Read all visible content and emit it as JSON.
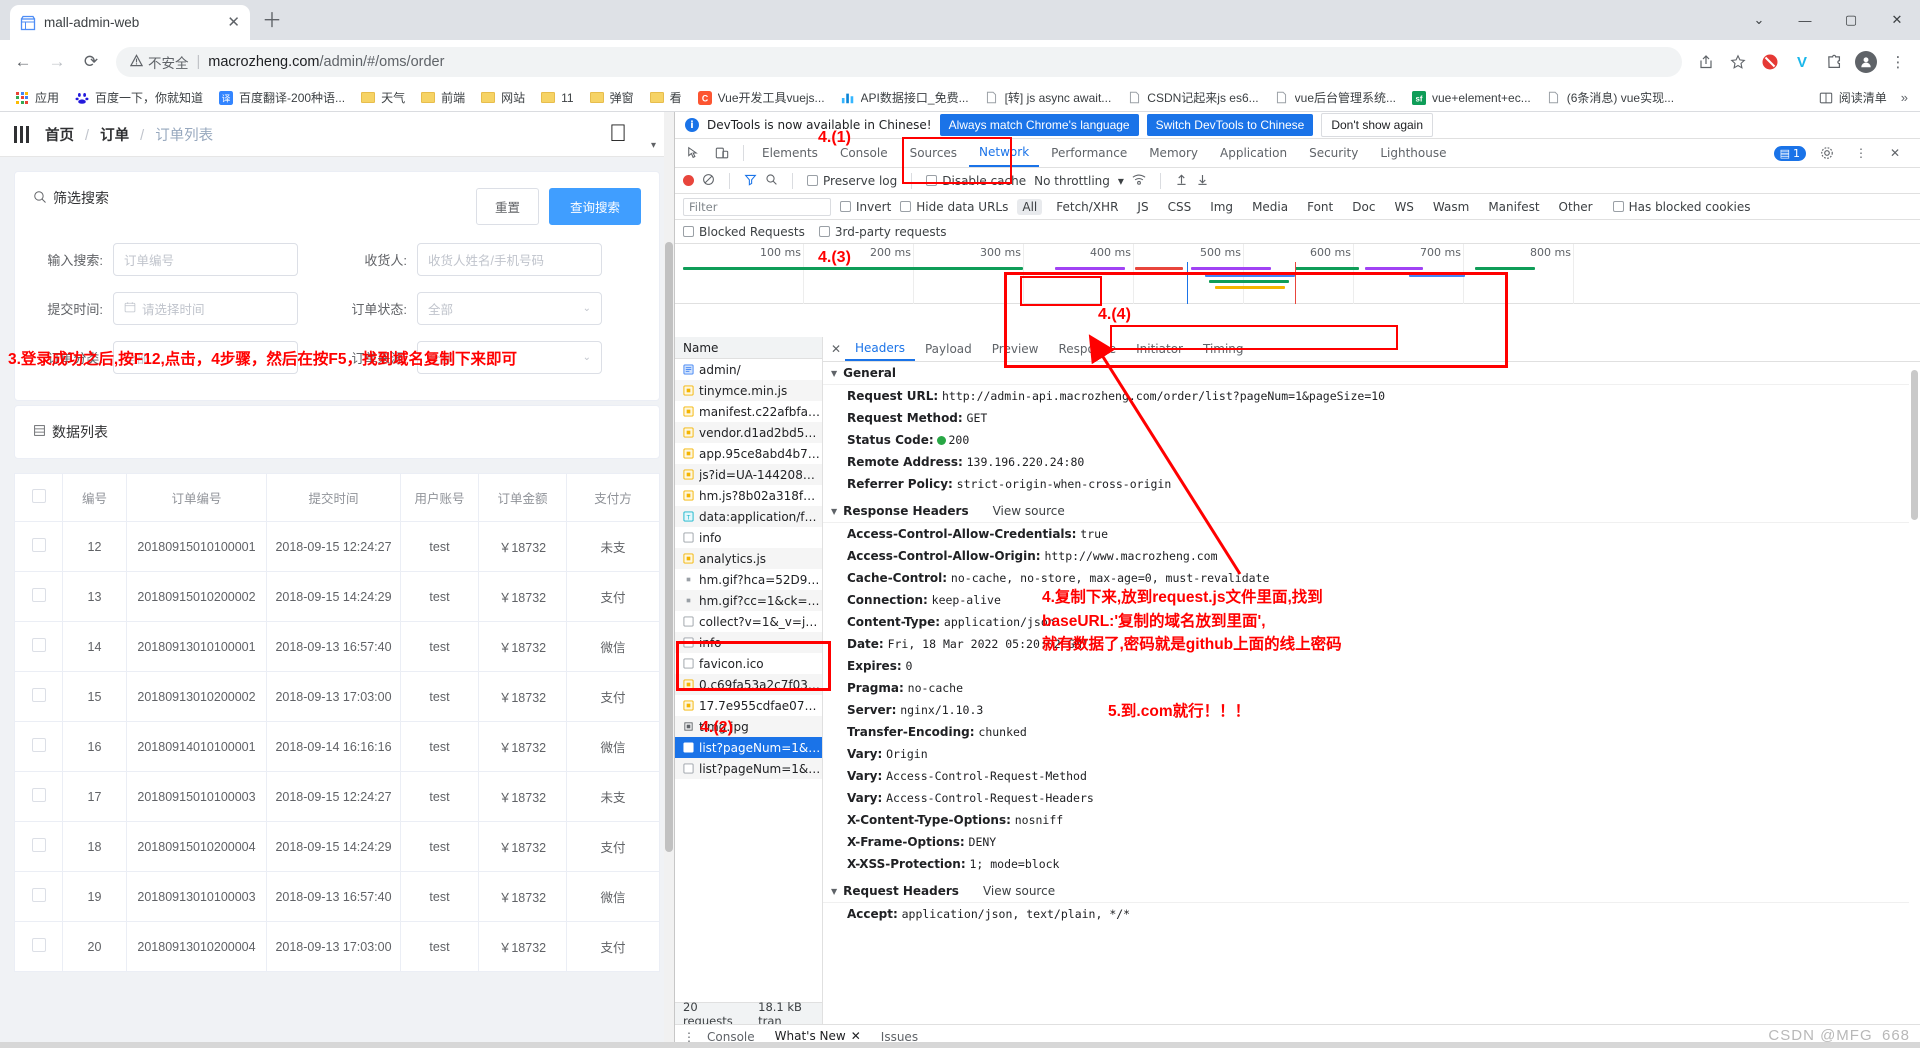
{
  "browser": {
    "tab": {
      "title": "mall-admin-web",
      "favicon_icon": "store-icon",
      "close_icon": "✕"
    },
    "new_tab_icon": "＋",
    "window_controls": {
      "minimize": "—",
      "maximize": "▢",
      "close": "✕",
      "chevron": "⌄"
    },
    "nav": {
      "back": "←",
      "forward": "→",
      "reload": "⟳"
    },
    "omnibox": {
      "security_warning": "不安全",
      "warning_icon": "warning-triangle-icon",
      "url_host": "macrozheng.com",
      "url_path": "/admin/#/oms/order"
    },
    "toolbar_icons": [
      "share-icon",
      "star-icon",
      "adblock-icon",
      "vimeo-icon",
      "puzzle-icon",
      "profile-icon",
      "menu-icon"
    ],
    "bookmarks": [
      {
        "label": "应用",
        "icon": "apps-grid-icon"
      },
      {
        "label": "百度一下，你就知道",
        "icon": "baidu-icon"
      },
      {
        "label": "百度翻译-200种语...",
        "icon": "translate-icon"
      },
      {
        "label": "天气",
        "icon": "folder-icon"
      },
      {
        "label": "前端",
        "icon": "folder-icon"
      },
      {
        "label": "网站",
        "icon": "folder-icon"
      },
      {
        "label": "11",
        "icon": "folder-icon"
      },
      {
        "label": "弹窗",
        "icon": "folder-icon"
      },
      {
        "label": "看",
        "icon": "folder-icon"
      },
      {
        "label": "Vue开发工具vuejs...",
        "icon": "csdn-icon"
      },
      {
        "label": "API数据接口_免费...",
        "icon": "chart-icon"
      },
      {
        "label": "[转] js async await...",
        "icon": "doc-icon"
      },
      {
        "label": "CSDN记起来js es6...",
        "icon": "doc-icon"
      },
      {
        "label": "vue后台管理系统...",
        "icon": "doc-icon"
      },
      {
        "label": "vue+element+ec...",
        "icon": "sf-icon"
      },
      {
        "label": "(6条消息) vue实现...",
        "icon": "doc-icon"
      }
    ],
    "bookmarks_right": {
      "label": "阅读清单",
      "icon": "reading-list-icon",
      "overflow_icon": "»"
    }
  },
  "app": {
    "breadcrumb": {
      "home": "首页",
      "section": "订单",
      "current": "订单列表",
      "separator": "/"
    },
    "hamburger_icon": "hamburger-icon",
    "apple_icon": "apple-logo-icon",
    "filter_card": {
      "title": "筛选搜索",
      "search_icon": "search-icon",
      "reset_label": "重置",
      "query_label": "查询搜索",
      "fields": [
        {
          "label": "输入搜索:",
          "placeholder": "订单编号",
          "type": "text"
        },
        {
          "label": "收货人:",
          "placeholder": "收货人姓名/手机号码",
          "type": "text"
        },
        {
          "label": "提交时间:",
          "placeholder": "请选择时间",
          "type": "date",
          "icon": "calendar-icon"
        },
        {
          "label": "订单状态:",
          "placeholder": "全部",
          "type": "select"
        },
        {
          "label": "订单分类:",
          "placeholder": "全部",
          "type": "select"
        },
        {
          "label": "订单来源:",
          "placeholder": "全部",
          "type": "select"
        }
      ]
    },
    "list_card": {
      "title": "数据列表",
      "icon": "list-icon"
    },
    "table": {
      "columns": [
        "",
        "编号",
        "订单编号",
        "提交时间",
        "用户账号",
        "订单金额",
        "支付方"
      ],
      "rows": [
        {
          "id": "12",
          "order_no": "20180915010100001",
          "time": "2018-09-15 12:24:27",
          "user": "test",
          "amount": "￥18732",
          "pay": "未支"
        },
        {
          "id": "13",
          "order_no": "20180915010200002",
          "time": "2018-09-15 14:24:29",
          "user": "test",
          "amount": "￥18732",
          "pay": "支付"
        },
        {
          "id": "14",
          "order_no": "20180913010100001",
          "time": "2018-09-13 16:57:40",
          "user": "test",
          "amount": "￥18732",
          "pay": "微信"
        },
        {
          "id": "15",
          "order_no": "20180913010200002",
          "time": "2018-09-13 17:03:00",
          "user": "test",
          "amount": "￥18732",
          "pay": "支付"
        },
        {
          "id": "16",
          "order_no": "20180914010100001",
          "time": "2018-09-14 16:16:16",
          "user": "test",
          "amount": "￥18732",
          "pay": "微信"
        },
        {
          "id": "17",
          "order_no": "20180915010100003",
          "time": "2018-09-15 12:24:27",
          "user": "test",
          "amount": "￥18732",
          "pay": "未支"
        },
        {
          "id": "18",
          "order_no": "20180915010200004",
          "time": "2018-09-15 14:24:29",
          "user": "test",
          "amount": "￥18732",
          "pay": "支付"
        },
        {
          "id": "19",
          "order_no": "20180913010100003",
          "time": "2018-09-13 16:57:40",
          "user": "test",
          "amount": "￥18732",
          "pay": "微信"
        },
        {
          "id": "20",
          "order_no": "20180913010200004",
          "time": "2018-09-13 17:03:00",
          "user": "test",
          "amount": "￥18732",
          "pay": "支付"
        }
      ]
    }
  },
  "devtools": {
    "banner": {
      "text": "DevTools is now available in Chinese!",
      "always_match": "Always match Chrome's language",
      "switch": "Switch DevTools to Chinese",
      "dont_show": "Don't show again"
    },
    "tabs": [
      "Elements",
      "Console",
      "Sources",
      "Network",
      "Performance",
      "Memory",
      "Application",
      "Security",
      "Lighthouse"
    ],
    "active_tab": "Network",
    "tab_icons": [
      "inspect-icon",
      "device-toolbar-icon"
    ],
    "right_icons": {
      "issues_count": "1",
      "settings_icon": "gear-icon",
      "more_icon": "kebab-icon",
      "close_icon": "close-icon"
    },
    "toolbar": {
      "record_icon": "record-icon",
      "clear_icon": "clear-icon",
      "filter_icon": "filter-funnel-icon",
      "search_icon": "search-icon",
      "preserve_log": "Preserve log",
      "disable_cache": "Disable cache",
      "throttling": "No throttling",
      "throttle_caret": "▾",
      "wifi_icon": "network-conditions-icon",
      "import_icon": "import-har-icon",
      "export_icon": "export-har-icon"
    },
    "filterbar": {
      "placeholder": "Filter",
      "invert": "Invert",
      "hide_data_urls": "Hide data URLs",
      "types": [
        "All",
        "Fetch/XHR",
        "JS",
        "CSS",
        "Img",
        "Media",
        "Font",
        "Doc",
        "WS",
        "Wasm",
        "Manifest",
        "Other"
      ],
      "active_type": "All",
      "has_blocked_cookies": "Has blocked cookies",
      "blocked_requests": "Blocked Requests",
      "third_party": "3rd-party requests"
    },
    "overview_ticks": [
      "100 ms",
      "200 ms",
      "300 ms",
      "400 ms",
      "500 ms",
      "600 ms",
      "700 ms",
      "800 ms"
    ],
    "name_column_header": "Name",
    "requests": [
      {
        "name": "admin/",
        "icon": "doc-icon",
        "type": "doc"
      },
      {
        "name": "tinymce.min.js",
        "icon": "js-icon",
        "type": "js"
      },
      {
        "name": "manifest.c22afbfaa36...",
        "icon": "js-icon",
        "type": "js"
      },
      {
        "name": "vendor.d1ad2bd51fe...",
        "icon": "js-icon",
        "type": "js"
      },
      {
        "name": "app.95ce8abd4b7179...",
        "icon": "js-icon",
        "type": "js"
      },
      {
        "name": "js?id=UA-144208445-2",
        "icon": "js-icon",
        "type": "js"
      },
      {
        "name": "hm.js?8b02a318fde58...",
        "icon": "js-icon",
        "type": "js"
      },
      {
        "name": "data:application/fo...",
        "icon": "font-icon",
        "type": "font"
      },
      {
        "name": "info",
        "icon": "xhr-icon",
        "type": "xhr"
      },
      {
        "name": "analytics.js",
        "icon": "js-icon",
        "type": "js"
      },
      {
        "name": "hm.gif?hca=52D98BA...",
        "icon": "img-icon",
        "type": "img"
      },
      {
        "name": "hm.gif?cc=1&ck=1&c...",
        "icon": "img-icon",
        "type": "img"
      },
      {
        "name": "collect?v=1&_v=j96&...",
        "icon": "xhr-icon",
        "type": "xhr"
      },
      {
        "name": "info",
        "icon": "xhr-icon",
        "type": "xhr"
      },
      {
        "name": "favicon.ico",
        "icon": "xhr-icon",
        "type": "other"
      },
      {
        "name": "0.c69fa53a2c7f03ae2...",
        "icon": "js-icon",
        "type": "js"
      },
      {
        "name": "17.7e955cdfae074128...",
        "icon": "js-icon",
        "type": "js"
      },
      {
        "name": "timg.jpg",
        "icon": "img-icon",
        "type": "img"
      },
      {
        "name": "list?pageNum=1&pa...",
        "icon": "xhr-icon",
        "type": "xhr",
        "selected": true
      },
      {
        "name": "list?pageNum=1&pa...",
        "icon": "xhr-icon",
        "type": "xhr"
      }
    ],
    "footer": {
      "requests": "20 requests",
      "transferred": "18.1 kB tran"
    },
    "detail_tabs": [
      "Headers",
      "Payload",
      "Preview",
      "Response",
      "Initiator",
      "Timing"
    ],
    "detail_active_tab": "Headers",
    "general": {
      "title": "General",
      "request_url_key": "Request URL:",
      "request_url_highlight": "http://admin-api.macrozheng.com",
      "request_url_rest": "/order/list?pageNum=1&pageSize=10",
      "request_method_key": "Request Method:",
      "request_method": "GET",
      "status_key": "Status Code:",
      "status": "200",
      "remote_key": "Remote Address:",
      "remote": "139.196.220.24:80",
      "referrer_key": "Referrer Policy:",
      "referrer": "strict-origin-when-cross-origin"
    },
    "response_headers": {
      "title": "Response Headers",
      "view_source": "View source",
      "items": [
        {
          "k": "Access-Control-Allow-Credentials:",
          "v": "true"
        },
        {
          "k": "Access-Control-Allow-Origin:",
          "v": "http://www.macrozheng.com"
        },
        {
          "k": "Cache-Control:",
          "v": "no-cache, no-store, max-age=0, must-revalidate"
        },
        {
          "k": "Connection:",
          "v": "keep-alive"
        },
        {
          "k": "Content-Type:",
          "v": "application/json"
        },
        {
          "k": "Date:",
          "v": "Fri, 18 Mar 2022 05:20:02 GMT"
        },
        {
          "k": "Expires:",
          "v": "0"
        },
        {
          "k": "Pragma:",
          "v": "no-cache"
        },
        {
          "k": "Server:",
          "v": "nginx/1.10.3"
        },
        {
          "k": "Transfer-Encoding:",
          "v": "chunked"
        },
        {
          "k": "Vary:",
          "v": "Origin"
        },
        {
          "k": "Vary:",
          "v": "Access-Control-Request-Method"
        },
        {
          "k": "Vary:",
          "v": "Access-Control-Request-Headers"
        },
        {
          "k": "X-Content-Type-Options:",
          "v": "nosniff"
        },
        {
          "k": "X-Frame-Options:",
          "v": "DENY"
        },
        {
          "k": "X-XSS-Protection:",
          "v": "1; mode=block"
        }
      ]
    },
    "request_headers": {
      "title": "Request Headers",
      "view_source": "View source",
      "items": [
        {
          "k": "Accept:",
          "v": "application/json, text/plain, */*"
        }
      ]
    },
    "drawer": {
      "console": "Console",
      "whats_new": "What's New",
      "issues": "Issues",
      "close_icon": "✕",
      "menu_icon": "⋮"
    }
  },
  "annotations": {
    "step3": "3.登录成功之后,按F12,点击，4步骤，然后在按F5，找到域名复制下来即可",
    "step4_1": "4.(1)",
    "step4_2": "4.(2)",
    "step4_3": "4.(3)",
    "step4_4": "4.(4)",
    "step4_note_line1": "4.复制下来,放到request.js文件里面,找到",
    "step4_note_line2": "baseURL:'复制的域名放到里面',",
    "step4_note_line3": "就有数据了,密码就是github上面的线上密码",
    "step5": "5.到.com就行！！！",
    "color": "#ff0000"
  },
  "watermark": "CSDN @MFG_668"
}
